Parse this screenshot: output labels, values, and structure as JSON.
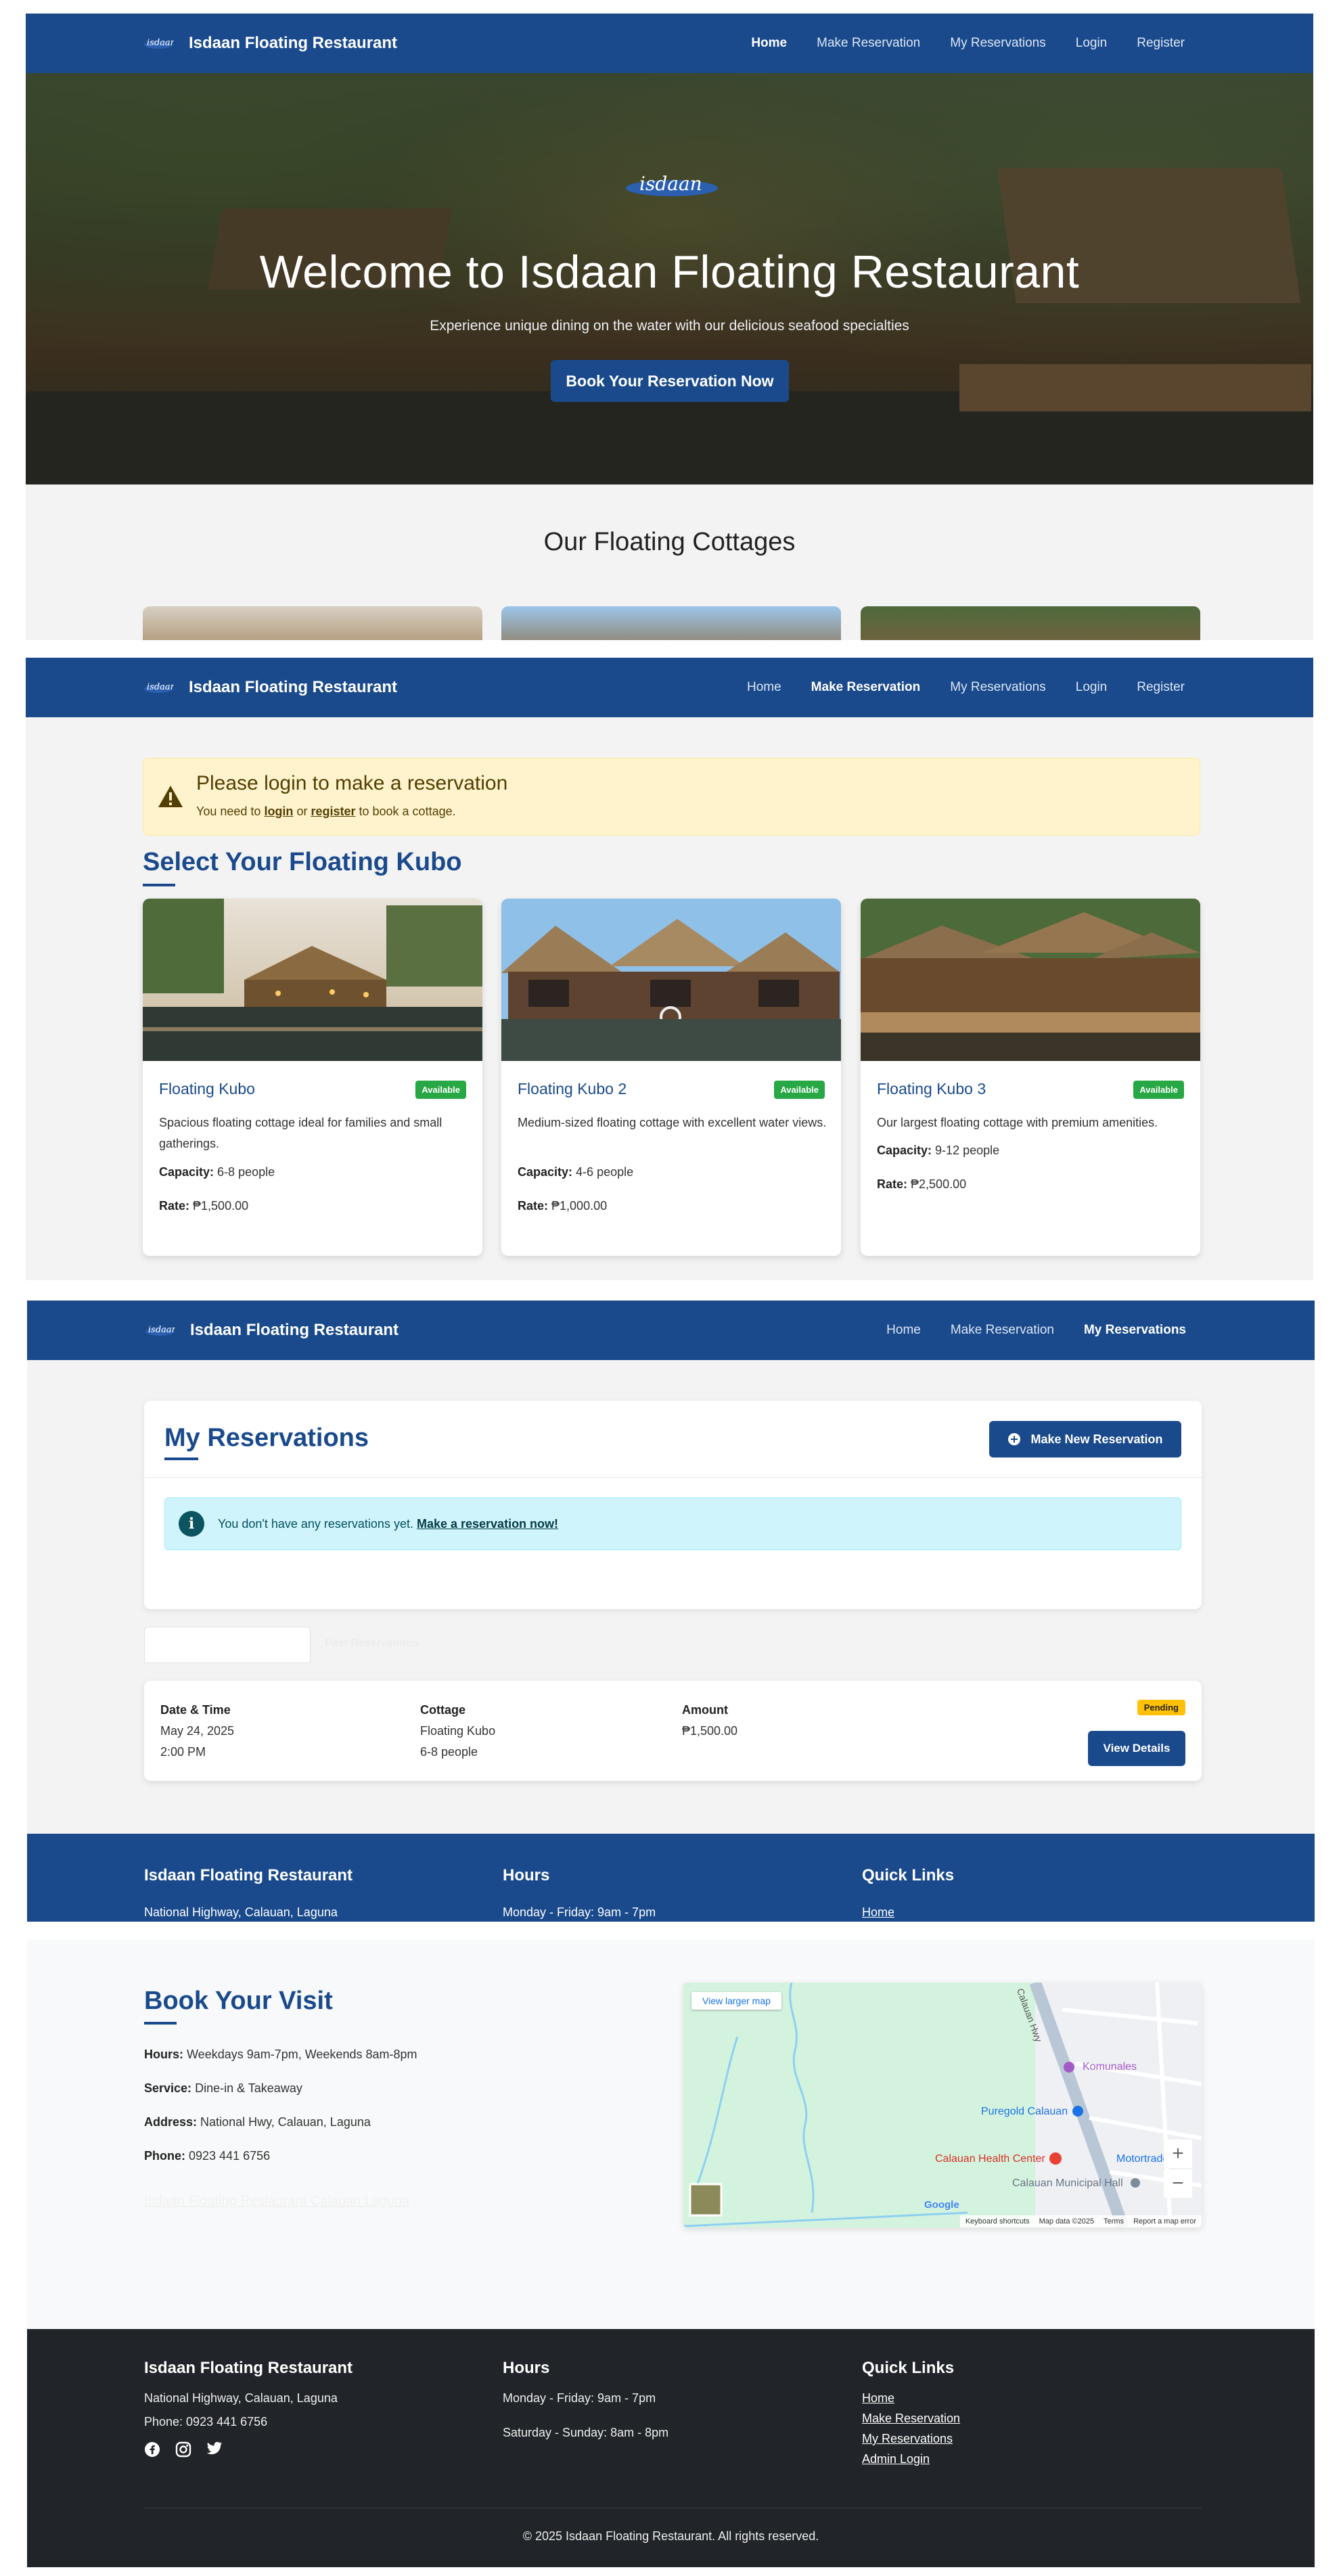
{
  "site": {
    "brand": "Isdaan Floating Restaurant",
    "logo_text": "isdaan"
  },
  "nav": {
    "home": "Home",
    "make_reservation": "Make Reservation",
    "my_reservations": "My Reservations",
    "login": "Login",
    "register": "Register"
  },
  "hero": {
    "title": "Welcome to Isdaan Floating Restaurant",
    "subtitle": "Experience unique dining on the water with our delicious seafood specialties",
    "cta": "Book Your Reservation Now"
  },
  "home_cottages": {
    "heading": "Our Floating Cottages"
  },
  "reservation": {
    "alert_title": "Please login to make a reservation",
    "alert_prefix": "You need to ",
    "alert_login": "login",
    "alert_or": " or ",
    "alert_register": "register",
    "alert_suffix": " to book a cottage.",
    "heading": "Select Your Floating Kubo",
    "capacity_label": "Capacity:",
    "rate_label": "Rate:",
    "cards": [
      {
        "name": "Floating Kubo",
        "status": "Available",
        "description": "Spacious floating cottage ideal for families and small gatherings.",
        "capacity": "6-8 people",
        "rate": "₱1,500.00"
      },
      {
        "name": "Floating Kubo 2",
        "status": "Available",
        "description": "Medium-sized floating cottage with excellent water views.",
        "capacity": "4-6 people",
        "rate": "₱1,000.00"
      },
      {
        "name": "Floating Kubo 3",
        "status": "Available",
        "description": "Our largest floating cottage with premium amenities.",
        "capacity": "9-12 people",
        "rate": "₱2,500.00"
      }
    ]
  },
  "my_reservations": {
    "title": "My Reservations",
    "new_button": "Make New Reservation",
    "empty_text": "You don't have any reservations yet. ",
    "empty_link": "Make a reservation now!",
    "tab_ghost": "Past Reservations",
    "row": {
      "date_label": "Date & Time",
      "date": "May 24, 2025",
      "time": "2:00 PM",
      "cottage_label": "Cottage",
      "cottage": "Floating Kubo",
      "capacity": "6-8 people",
      "amount_label": "Amount",
      "amount": "₱1,500.00",
      "status": "Pending",
      "view_button": "View Details"
    }
  },
  "visit": {
    "title": "Book Your Visit",
    "hours_label": "Hours:",
    "hours": "Weekdays 9am-7pm, Weekends 8am-8pm",
    "service_label": "Service:",
    "service": "Dine-in & Takeaway",
    "address_label": "Address:",
    "address": "National Hwy, Calauan, Laguna",
    "phone_label": "Phone:",
    "phone": "0923 441 6756",
    "ghost_link": "Isdaan Floating Restaurant Calauan Laguna",
    "map": {
      "view_larger": "View larger map",
      "road": "Calauan Hwy",
      "places": [
        "Komunales",
        "Puregold Calauan",
        "Calauan Health Center",
        "Calauan Municipal Hall",
        "Motortrade"
      ],
      "attribution": [
        "Keyboard shortcuts",
        "Map data ©2025",
        "Terms",
        "Report a map error"
      ],
      "logo": "Google"
    }
  },
  "footer": {
    "col1_title": "Isdaan Floating Restaurant",
    "address": "National Highway, Calauan, Laguna",
    "phone": "Phone: 0923 441 6756",
    "col2_title": "Hours",
    "hours_weekday": "Monday - Friday: 9am - 7pm",
    "hours_weekend": "Saturday - Sunday: 8am - 8pm",
    "col3_title": "Quick Links",
    "links": [
      "Home",
      "Make Reservation",
      "My Reservations",
      "Admin Login"
    ],
    "copyright": "© 2025 Isdaan Floating Restaurant. All rights reserved."
  },
  "colors": {
    "primary": "#1a4a8c",
    "success": "#28a745",
    "warning_bg": "#fff3cd",
    "info_bg": "#cff4fc",
    "pending": "#ffc107",
    "footer_bg": "#212529"
  }
}
